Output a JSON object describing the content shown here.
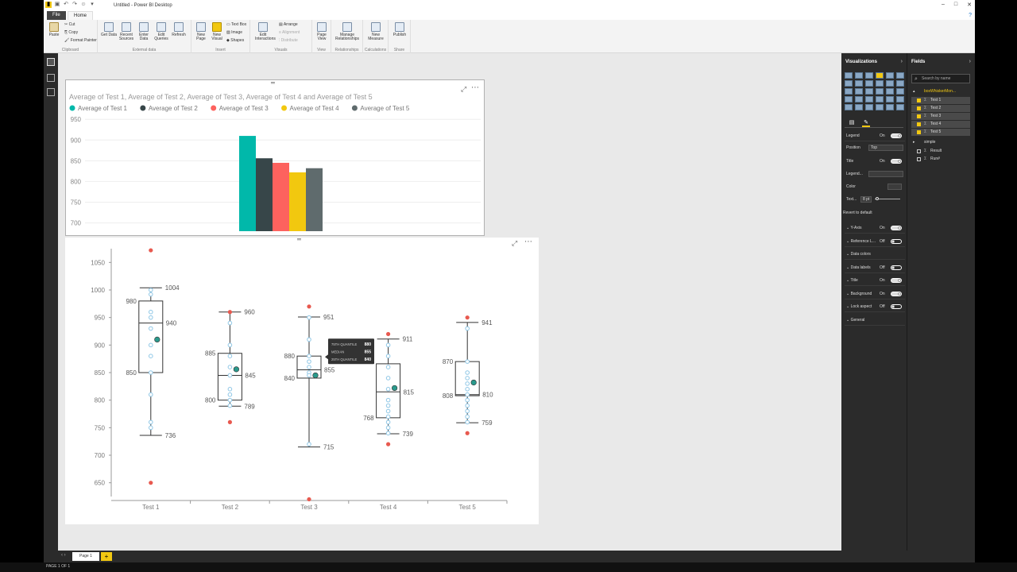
{
  "window": {
    "title": "Untitled - Power BI Desktop"
  },
  "tabs": [
    {
      "label": "File"
    },
    {
      "label": "Home"
    }
  ],
  "ribbon": {
    "clipboard": {
      "paste": "Paste",
      "cut": "Cut",
      "copy": "Copy",
      "format_painter": "Format Painter",
      "group": "Clipboard"
    },
    "external": {
      "get_data": "Get Data",
      "recent_sources": "Recent Sources",
      "enter_data": "Enter Data",
      "edit_queries": "Edit Queries",
      "refresh": "Refresh",
      "group": "External data"
    },
    "insert": {
      "new_page": "New Page",
      "new_visual": "New Visual",
      "text_box": "Text Box",
      "image": "Image",
      "shapes": "Shapes",
      "group": "Insert"
    },
    "visuals": {
      "edit_interactions": "Edit Interactions",
      "arrange": "Arrange",
      "alignment": "Alignment",
      "distribute": "Distribute",
      "group": "Visuals"
    },
    "view": {
      "page_view": "Page View",
      "group": "View"
    },
    "relationships": {
      "manage": "Manage Relationships",
      "group": "Relationships"
    },
    "calculations": {
      "new_measure": "New Measure",
      "group": "Calculations"
    },
    "share": {
      "publish": "Publish",
      "group": "Share"
    }
  },
  "viz_pane": {
    "title": "Visualizations",
    "legend": {
      "label": "Legend",
      "state": "On"
    },
    "position": {
      "label": "Position",
      "value": "Top"
    },
    "title_row": {
      "label": "Title",
      "state": "On"
    },
    "legend_name": {
      "label": "Legend..."
    },
    "color": {
      "label": "Color"
    },
    "text_size": {
      "label": "Text...",
      "value": "8 pt"
    },
    "revert": "Revert to default",
    "sections": [
      {
        "label": "Y-Axis",
        "state": "On"
      },
      {
        "label": "Reference L...",
        "state": "Off"
      },
      {
        "label": "Data colors",
        "state": ""
      },
      {
        "label": "Data labels",
        "state": "Off"
      },
      {
        "label": "Title",
        "state": "On"
      },
      {
        "label": "Background",
        "state": "On"
      },
      {
        "label": "Lock aspect",
        "state": "Off"
      },
      {
        "label": "General",
        "state": ""
      }
    ]
  },
  "fields_pane": {
    "title": "Fields",
    "search_placeholder": "Search by name",
    "table1": "boxWhiskerMon...",
    "table1_fields": [
      "Test 1",
      "Test 2",
      "Test 3",
      "Test 4",
      "Test 5"
    ],
    "table2": "simple",
    "table2_fields": [
      "Result",
      "Run#"
    ]
  },
  "status": {
    "page_tab": "Page 1",
    "page_of": "PAGE 1 OF 1",
    "add": "+"
  },
  "colors": {
    "teal": "#01b8aa",
    "dark": "#374649",
    "red": "#fd625e",
    "yellow": "#f2c80f",
    "gray": "#5f6b6d",
    "accent": "#f2c811"
  },
  "chart_data": [
    {
      "type": "bar",
      "title": "Average of Test 1, Average of Test 2, Average of Test 3, Average of Test 4 and Average of Test 5",
      "series": [
        {
          "name": "Average of Test 1",
          "values": [
            910
          ],
          "color": "#01b8aa"
        },
        {
          "name": "Average of Test 2",
          "values": [
            856
          ],
          "color": "#374649"
        },
        {
          "name": "Average of Test 3",
          "values": [
            845
          ],
          "color": "#fd625e"
        },
        {
          "name": "Average of Test 4",
          "values": [
            822
          ],
          "color": "#f2c80f"
        },
        {
          "name": "Average of Test 5",
          "values": [
            832
          ],
          "color": "#5f6b6d"
        }
      ],
      "ylim": [
        680,
        960
      ],
      "yticks": [
        700,
        750,
        800,
        850,
        900,
        950
      ],
      "legend": "top-left",
      "grid": true
    },
    {
      "type": "boxplot",
      "categories": [
        "Test 1",
        "Test 2",
        "Test 3",
        "Test 4",
        "Test 5"
      ],
      "ylim": [
        625,
        1075
      ],
      "yticks": [
        650,
        700,
        750,
        800,
        850,
        900,
        950,
        1000,
        1050
      ],
      "boxes": [
        {
          "whisker_low": 736,
          "q1": 850,
          "median": 940,
          "q3": 980,
          "whisker_high": 1004,
          "mean": 910,
          "low_label": "736",
          "q1_label": "850",
          "median_label": "940",
          "q3_label": "980",
          "high_label": "1004",
          "outliers": [
            1072,
            650
          ],
          "points": [
            1000,
            992,
            960,
            950,
            930,
            900,
            880,
            850,
            810,
            760,
            750
          ]
        },
        {
          "whisker_low": 789,
          "q1": 800,
          "median": 845,
          "q3": 885,
          "whisker_high": 960,
          "mean": 856,
          "low_label": "789",
          "q1_label": "800",
          "median_label": "845",
          "q3_label": "885",
          "high_label": "960",
          "outliers": [
            960,
            760
          ],
          "points": [
            940,
            900,
            880,
            860,
            845,
            820,
            810,
            800,
            790
          ]
        },
        {
          "whisker_low": 715,
          "q1": 840,
          "median": 855,
          "q3": 880,
          "whisker_high": 951,
          "mean": 845,
          "low_label": "715",
          "q1_label": "840",
          "median_label": "855",
          "q3_label": "880",
          "high_label": "951",
          "outliers": [
            970,
            620
          ],
          "points": [
            950,
            910,
            880,
            870,
            860,
            850,
            845,
            720
          ]
        },
        {
          "whisker_low": 739,
          "q1": 768,
          "median": 815,
          "q3": 866,
          "whisker_high": 911,
          "mean": 822,
          "low_label": "739",
          "q1_label": "768",
          "median_label": "815",
          "q3_label": "",
          "high_label": "911",
          "outliers": [
            920,
            720
          ],
          "points": [
            900,
            880,
            860,
            840,
            820,
            800,
            790,
            780,
            770,
            760,
            750,
            740
          ]
        },
        {
          "whisker_low": 759,
          "q1": 808,
          "median": 810,
          "q3": 870,
          "whisker_high": 941,
          "mean": 832,
          "low_label": "759",
          "q1_label": "808",
          "median_label": "810",
          "q3_label": "870",
          "high_label": "941",
          "outliers": [
            950,
            740
          ],
          "points": [
            930,
            870,
            850,
            840,
            830,
            820,
            810,
            800,
            790,
            780,
            770,
            760
          ]
        }
      ],
      "tooltip": {
        "rows": [
          {
            "label": "75TH QUANTILE",
            "value": "880"
          },
          {
            "label": "MEDIAN",
            "value": "855"
          },
          {
            "label": "25TH QUANTILE",
            "value": "840"
          }
        ]
      }
    }
  ]
}
